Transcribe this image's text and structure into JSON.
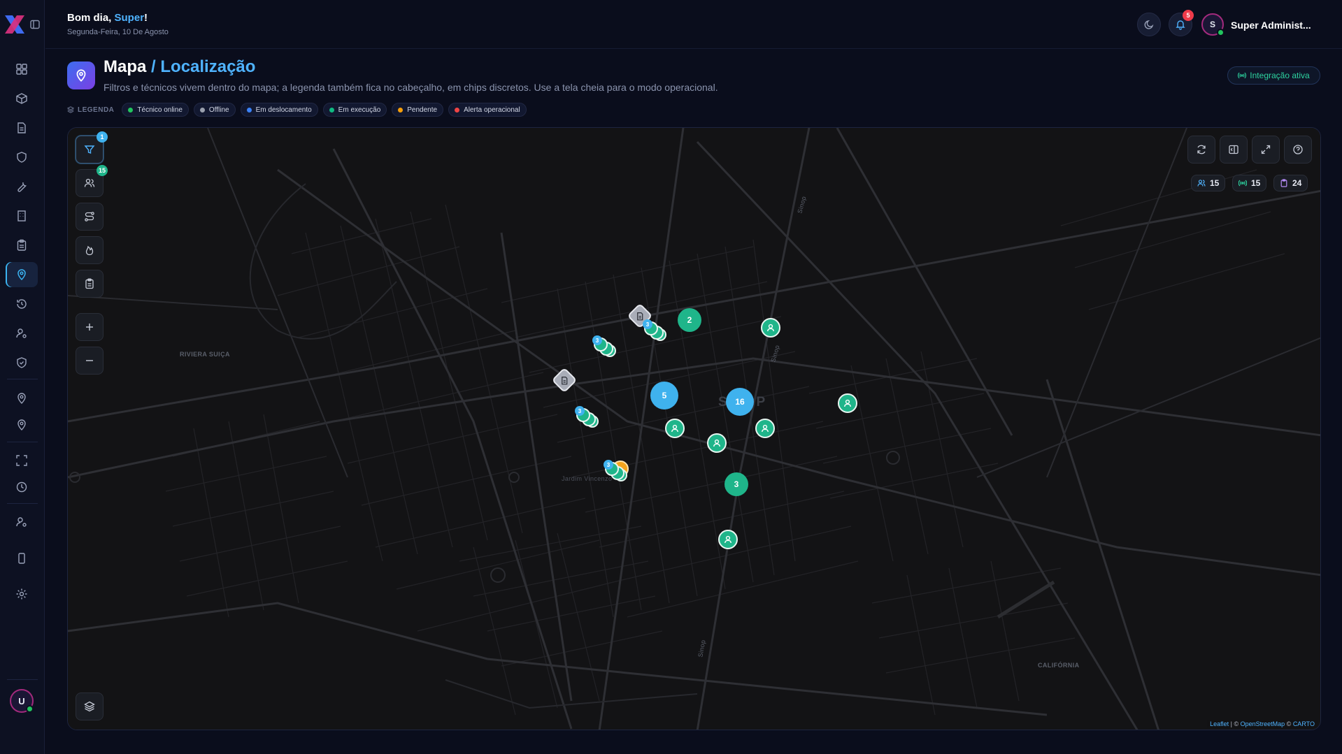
{
  "header": {
    "greeting_prefix": "Bom dia,",
    "greeting_name": "Super",
    "greeting_suffix": "!",
    "date": "Segunda-Feira, 10 De Agosto",
    "notifications_count": "5",
    "avatar_initial": "S",
    "user_name": "Super Administ..."
  },
  "sidebar": {
    "items": [
      "dashboard-icon",
      "box-icon",
      "file-icon",
      "shield-icon",
      "wrench-icon",
      "building-icon",
      "clipboard-icon",
      "map-pin-icon",
      "history-icon",
      "user-cog-icon",
      "shield-check-icon",
      "map-pin-icon",
      "map-pin-icon",
      "scan-icon",
      "clock-icon",
      "user-cog-icon",
      "tablet-icon",
      "gear-icon"
    ],
    "active_item": "map-pin-icon",
    "user_initial": "U"
  },
  "page": {
    "title": "Mapa",
    "title_sub": "/ Localização",
    "description": "Filtros e técnicos vivem dentro do mapa; a legenda também fica no cabeçalho, em chips discretos. Use a tela cheia para o modo operacional.",
    "integration_status": "Integração ativa"
  },
  "legend": {
    "label": "LEGENDA",
    "items": [
      {
        "label": "Técnico online",
        "color": "#22c55e"
      },
      {
        "label": "Offline",
        "color": "#9aa0ad"
      },
      {
        "label": "Em deslocamento",
        "color": "#3b82f6"
      },
      {
        "label": "Em execução",
        "color": "#10b981"
      },
      {
        "label": "Pendente",
        "color": "#f59e0b"
      },
      {
        "label": "Alerta operacional",
        "color": "#ef4444"
      }
    ]
  },
  "map": {
    "filter_badge": "1",
    "technicians_badge": "15",
    "stats": {
      "technicians": "15",
      "signals": "15",
      "orders": "24"
    },
    "labels": {
      "neighborhood_1": "RIVIERA SUIÇA",
      "neighborhood_2": "CALIFÓRNIA",
      "city": "SINOP",
      "street_1": "Sinop",
      "street_2": "Sinop",
      "street_3": "Sinop",
      "district": "Jardim Vincenzo"
    },
    "clusters": {
      "c5": "5",
      "c16": "16",
      "c2": "2",
      "c3": "3"
    },
    "group_count": "3",
    "attribution": {
      "leaflet": "Leaflet",
      "sep1": " | © ",
      "osm": "OpenStreetMap",
      "sep2": " © ",
      "carto": "CARTO"
    }
  },
  "colors": {
    "accent": "#4fb3ff",
    "tech_online": "#1fb58a",
    "cluster_blue": "#3fb2ee",
    "pending": "#f2a31c",
    "alert": "#ef3b4a"
  }
}
